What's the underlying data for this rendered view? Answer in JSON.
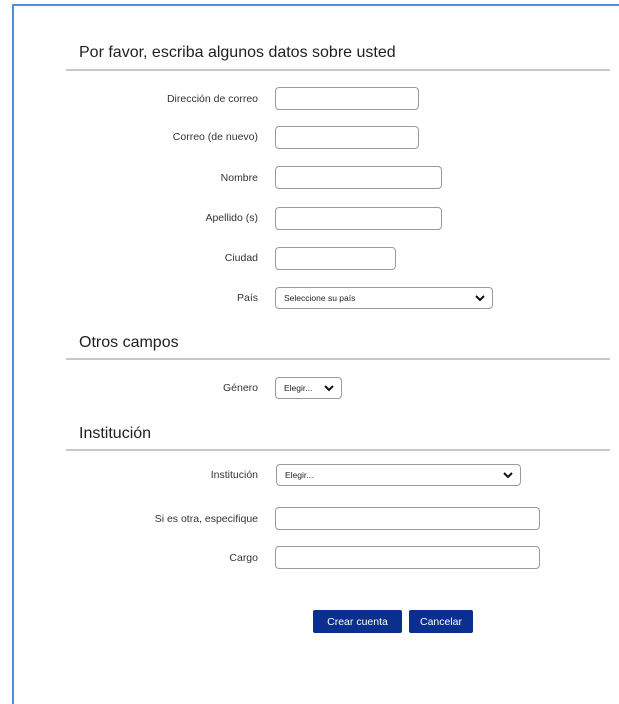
{
  "sections": {
    "personal_title": "Por favor, escriba algunos datos sobre usted",
    "other_title": "Otros campos",
    "institution_title": "Institución"
  },
  "fields": {
    "email_label": "Dirección de correo",
    "email_again_label": "Correo (de nuevo)",
    "first_name_label": "Nombre",
    "last_name_label": "Apellido (s)",
    "city_label": "Ciudad",
    "country_label": "País",
    "country_value": "Seleccione su país",
    "gender_label": "Género",
    "gender_value": "Elegir...",
    "institution_label": "Institución",
    "institution_value": "Elegir...",
    "other_label": "Si es otra, especifique",
    "position_label": "Cargo"
  },
  "buttons": {
    "create": "Crear cuenta",
    "cancel": "Cancelar"
  },
  "colors": {
    "accent": "#0a2f8f",
    "frame_border": "#4a90d9"
  },
  "icons": {
    "dropdown": "chevron-down-icon"
  }
}
